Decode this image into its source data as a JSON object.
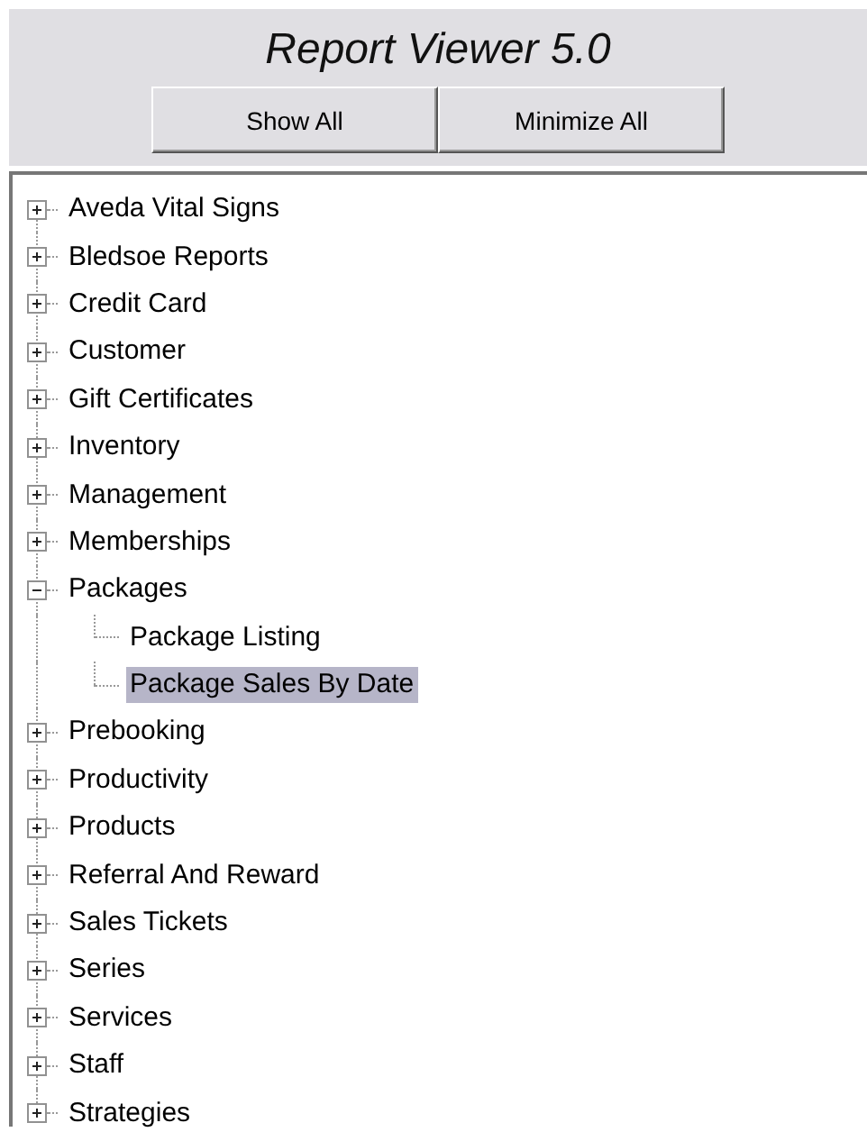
{
  "header": {
    "title": "Report Viewer 5.0",
    "buttons": [
      "Show All",
      "Minimize All"
    ]
  },
  "tree": [
    {
      "label": "Aveda Vital Signs",
      "expanded": false,
      "selected": false
    },
    {
      "label": "Bledsoe Reports",
      "expanded": false,
      "selected": false
    },
    {
      "label": "Credit Card",
      "expanded": false,
      "selected": false
    },
    {
      "label": "Customer",
      "expanded": false,
      "selected": false
    },
    {
      "label": "Gift Certificates",
      "expanded": false,
      "selected": false
    },
    {
      "label": "Inventory",
      "expanded": false,
      "selected": false
    },
    {
      "label": "Management",
      "expanded": false,
      "selected": false
    },
    {
      "label": "Memberships",
      "expanded": false,
      "selected": false
    },
    {
      "label": "Packages",
      "expanded": true,
      "selected": false,
      "children": [
        {
          "label": "Package Listing",
          "selected": false
        },
        {
          "label": "Package Sales By Date",
          "selected": true
        }
      ]
    },
    {
      "label": "Prebooking",
      "expanded": false,
      "selected": false
    },
    {
      "label": "Productivity",
      "expanded": false,
      "selected": false
    },
    {
      "label": "Products",
      "expanded": false,
      "selected": false
    },
    {
      "label": "Referral And Reward",
      "expanded": false,
      "selected": false
    },
    {
      "label": "Sales Tickets",
      "expanded": false,
      "selected": false
    },
    {
      "label": "Series",
      "expanded": false,
      "selected": false
    },
    {
      "label": "Services",
      "expanded": false,
      "selected": false
    },
    {
      "label": "Staff",
      "expanded": false,
      "selected": false
    },
    {
      "label": "Strategies",
      "expanded": false,
      "selected": false
    }
  ]
}
